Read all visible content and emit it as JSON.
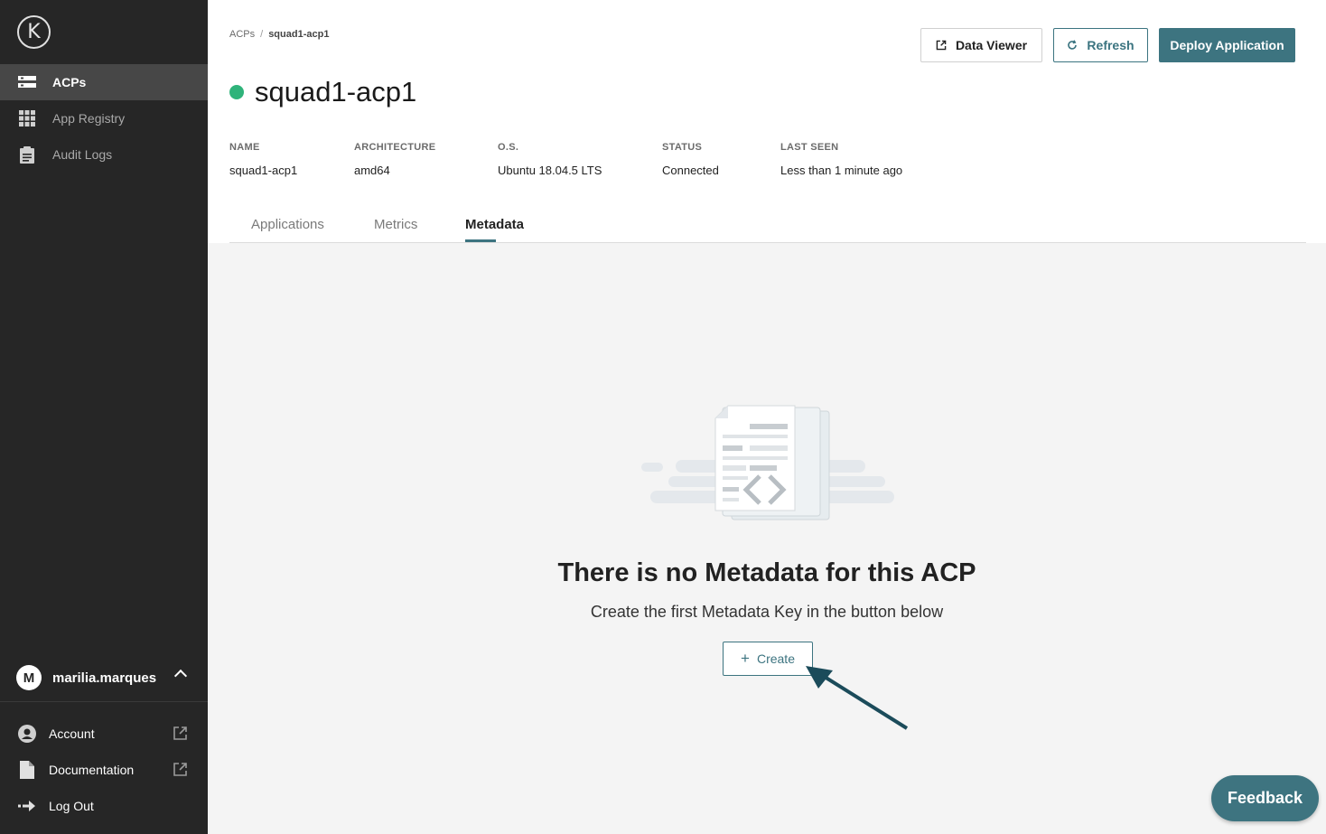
{
  "sidebar": {
    "logo_letter": "K",
    "nav": [
      {
        "label": "ACPs",
        "icon": "server-icon",
        "active": true
      },
      {
        "label": "App Registry",
        "icon": "grid-icon",
        "active": false
      },
      {
        "label": "Audit Logs",
        "icon": "clipboard-icon",
        "active": false
      }
    ],
    "user": {
      "initial": "M",
      "name": "marilia.marques"
    },
    "bottom": [
      {
        "label": "Account",
        "icon": "user-circle-icon"
      },
      {
        "label": "Documentation",
        "icon": "document-icon"
      },
      {
        "label": "Log Out",
        "icon": "logout-arrow-icon"
      }
    ]
  },
  "breadcrumb": {
    "root": "ACPs",
    "separator": "/",
    "current": "squad1-acp1"
  },
  "header": {
    "title": "squad1-acp1",
    "status_color": "#2fb37a",
    "buttons": {
      "data_viewer": "Data Viewer",
      "refresh": "Refresh",
      "deploy": "Deploy Application"
    }
  },
  "details": {
    "name": {
      "label": "NAME",
      "value": "squad1-acp1"
    },
    "architecture": {
      "label": "ARCHITECTURE",
      "value": "amd64"
    },
    "os": {
      "label": "O.S.",
      "value": "Ubuntu 18.04.5 LTS"
    },
    "status": {
      "label": "STATUS",
      "value": "Connected"
    },
    "last_seen": {
      "label": "LAST SEEN",
      "value": "Less than 1 minute ago"
    }
  },
  "tabs": [
    {
      "label": "Applications",
      "active": false
    },
    {
      "label": "Metrics",
      "active": false
    },
    {
      "label": "Metadata",
      "active": true
    }
  ],
  "empty_state": {
    "title": "There is no Metadata for this ACP",
    "subtitle": "Create the first Metadata Key in the button below",
    "create_label": "Create"
  },
  "feedback_label": "Feedback",
  "colors": {
    "accent": "#3d7480",
    "sidebar": "#262626",
    "status_ok": "#2fb37a"
  }
}
